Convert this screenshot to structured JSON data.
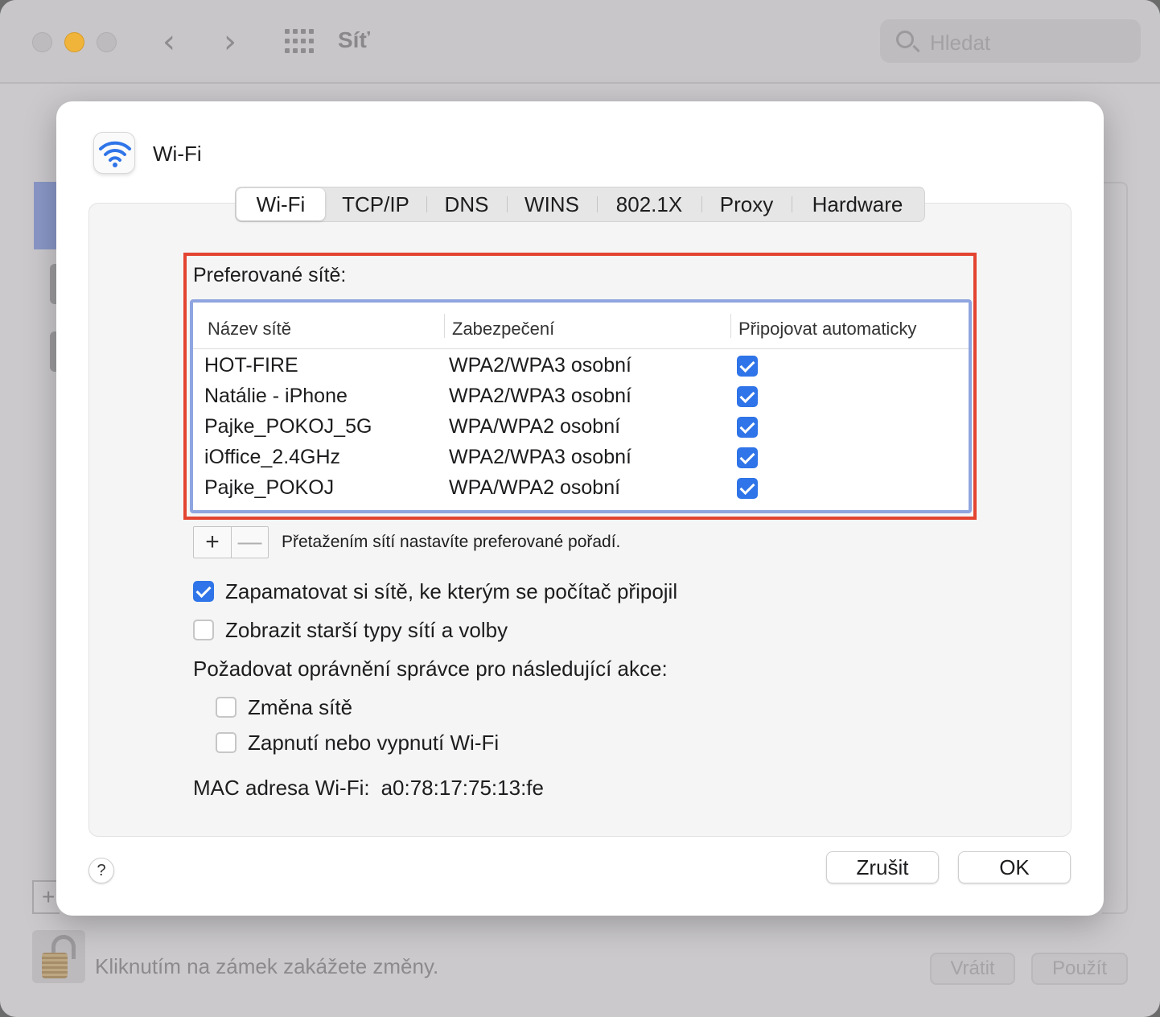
{
  "window": {
    "title": "Síť",
    "search_placeholder": "Hledat",
    "lock_text": "Kliknutím na zámek zakážete změny.",
    "revert_label": "Vrátit",
    "apply_label": "Použít",
    "add_label": "+"
  },
  "sheet": {
    "title": "Wi-Fi",
    "tabs": [
      {
        "label": "Wi-Fi",
        "active": true
      },
      {
        "label": "TCP/IP",
        "active": false
      },
      {
        "label": "DNS",
        "active": false
      },
      {
        "label": "WINS",
        "active": false
      },
      {
        "label": "802.1X",
        "active": false
      },
      {
        "label": "Proxy",
        "active": false
      },
      {
        "label": "Hardware",
        "active": false
      }
    ],
    "preferred_label": "Preferované sítě:",
    "table": {
      "columns": [
        "Název sítě",
        "Zabezpečení",
        "Připojovat automaticky"
      ],
      "rows": [
        {
          "name": "HOT-FIRE",
          "security": "WPA2/WPA3 osobní",
          "auto": true
        },
        {
          "name": "Natálie - iPhone",
          "security": "WPA2/WPA3 osobní",
          "auto": true
        },
        {
          "name": "Pajke_POKOJ_5G",
          "security": "WPA/WPA2 osobní",
          "auto": true
        },
        {
          "name": "iOffice_2.4GHz",
          "security": "WPA2/WPA3 osobní",
          "auto": true
        },
        {
          "name": "Pajke_POKOJ",
          "security": "WPA/WPA2 osobní",
          "auto": true
        }
      ]
    },
    "add_symbol": "+",
    "remove_symbol": "—",
    "drag_hint": "Přetažením sítí nastavíte preferované pořadí.",
    "remember_label": "Zapamatovat si sítě, ke kterým se počítač připojil",
    "remember_checked": true,
    "legacy_label": "Zobrazit starší typy sítí a volby",
    "legacy_checked": false,
    "admin_label": "Požadovat oprávnění správce pro následující akce:",
    "change_network_label": "Změna sítě",
    "change_network_checked": false,
    "toggle_wifi_label": "Zapnutí nebo vypnutí Wi-Fi",
    "toggle_wifi_checked": false,
    "mac_label": "MAC adresa Wi-Fi:",
    "mac_value": "a0:78:17:75:13:fe",
    "help_label": "?",
    "cancel_label": "Zrušit",
    "ok_label": "OK"
  },
  "colors": {
    "accent": "#2f74e8",
    "highlight_box": "#e34431",
    "table_focus": "#8fa5e0"
  }
}
